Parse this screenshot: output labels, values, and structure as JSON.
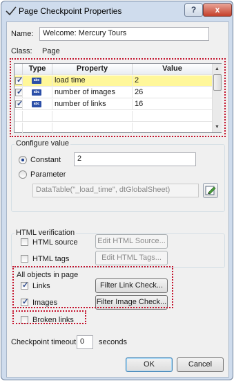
{
  "window": {
    "title": "Page Checkpoint Properties",
    "help_label": "?",
    "close_label": "x"
  },
  "name": {
    "label": "Name:",
    "value": "Welcome: Mercury Tours"
  },
  "class": {
    "label": "Class:",
    "value": "Page"
  },
  "grid": {
    "headers": [
      "Type",
      "Property",
      "Value"
    ],
    "rows": [
      {
        "checked": true,
        "type_icon": "abc",
        "property": "load time",
        "value": "2",
        "selected": true
      },
      {
        "checked": true,
        "type_icon": "abc",
        "property": "number of images",
        "value": "26",
        "selected": false
      },
      {
        "checked": true,
        "type_icon": "abc",
        "property": "number of links",
        "value": "16",
        "selected": false
      }
    ]
  },
  "configure": {
    "title": "Configure value",
    "constant_label": "Constant",
    "constant_value": "2",
    "constant_selected": true,
    "parameter_label": "Parameter",
    "parameter_value": "DataTable(\"_load_time\", dtGlobalSheet)"
  },
  "html_verification": {
    "title": "HTML verification",
    "source_label": "HTML source",
    "source_checked": false,
    "source_button": "Edit HTML Source...",
    "tags_label": "HTML tags",
    "tags_checked": false,
    "tags_button": "Edit HTML Tags..."
  },
  "all_objects": {
    "title": "All objects in page",
    "links_label": "Links",
    "links_checked": true,
    "links_button": "Filter Link Check...",
    "images_label": "Images",
    "images_checked": true,
    "images_button": "Filter Image Check...",
    "broken_label": "Broken links",
    "broken_checked": false
  },
  "timeout": {
    "label": "Checkpoint timeout:",
    "value": "0",
    "unit": "seconds"
  },
  "buttons": {
    "ok": "OK",
    "cancel": "Cancel"
  },
  "colors": {
    "highlight": "#c4122c",
    "selected_row": "#fff79a",
    "abc_icon": "#2b4fa8"
  }
}
